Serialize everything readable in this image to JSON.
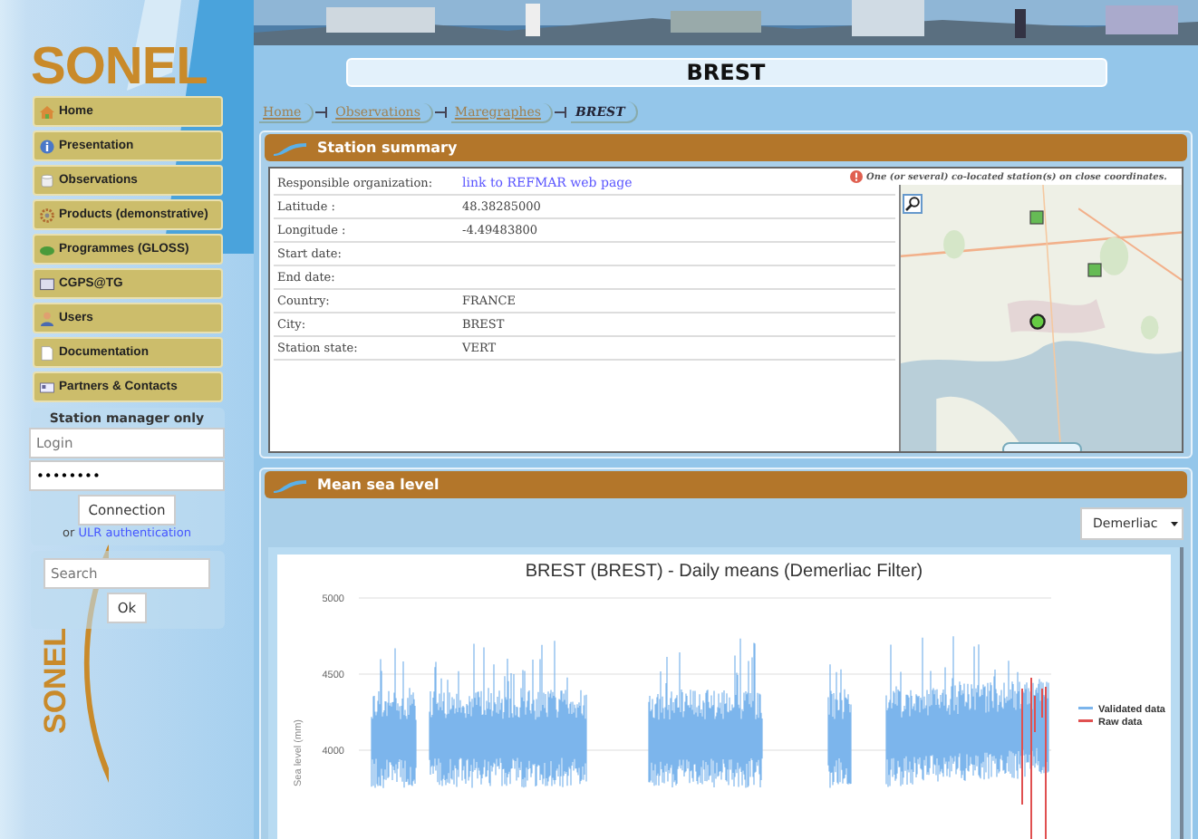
{
  "logo": {
    "text": "SONEL"
  },
  "nav": [
    {
      "label": "Home"
    },
    {
      "label": "Presentation"
    },
    {
      "label": "Observations"
    },
    {
      "label": "Products (demonstrative)"
    },
    {
      "label": "Programmes (GLOSS)"
    },
    {
      "label": "CGPS@TG"
    },
    {
      "label": "Users"
    },
    {
      "label": "Documentation"
    },
    {
      "label": "Partners & Contacts"
    }
  ],
  "login": {
    "title": "Station manager only",
    "login_placeholder": "Login",
    "password_value": "••••••••",
    "button": "Connection",
    "alt_prefix": "or",
    "alt_link": "ULR authentication"
  },
  "search": {
    "placeholder": "Search",
    "button": "Ok"
  },
  "side_mark": "SONEL",
  "page_title": "BREST",
  "breadcrumb": [
    {
      "label": "Home",
      "selected": false
    },
    {
      "label": "Observations",
      "selected": false
    },
    {
      "label": "Maregraphes",
      "selected": false
    },
    {
      "label": "BREST",
      "selected": true
    }
  ],
  "summary": {
    "title": "Station summary",
    "rows": [
      {
        "label": "Responsible organization:",
        "value": "link to REFMAR web page",
        "kind": "link"
      },
      {
        "label": "Latitude :",
        "value": "48.38285000",
        "kind": "text"
      },
      {
        "label": "Longitude :",
        "value": "-4.49483800",
        "kind": "text"
      },
      {
        "label": "Start date:",
        "kind": "text"
      },
      {
        "label": "End date:",
        "kind": "text"
      },
      {
        "label": "Country:",
        "value": "FRANCE",
        "kind": "text"
      },
      {
        "label": "City:",
        "value": "BREST",
        "kind": "text"
      },
      {
        "label": "Station state:",
        "value": "VERT",
        "kind": "text"
      }
    ],
    "map_note": "One (or several) co-located station(s) on close coordinates.",
    "markers": [
      {
        "kind": "square"
      },
      {
        "kind": "square"
      },
      {
        "kind": "circle"
      }
    ]
  },
  "msl": {
    "title": "Mean sea level",
    "filter": "Demerliac",
    "plot": {
      "title": "BREST (BREST) - Daily means (Demerliac Filter)",
      "ylabel": "Sea level (mm)",
      "yticks": [
        "5000",
        "4500",
        "4000"
      ],
      "legend": [
        {
          "name": "Validated data",
          "color": "#7cb5ec"
        },
        {
          "name": "Raw data",
          "color": "#e05050"
        }
      ]
    }
  }
}
